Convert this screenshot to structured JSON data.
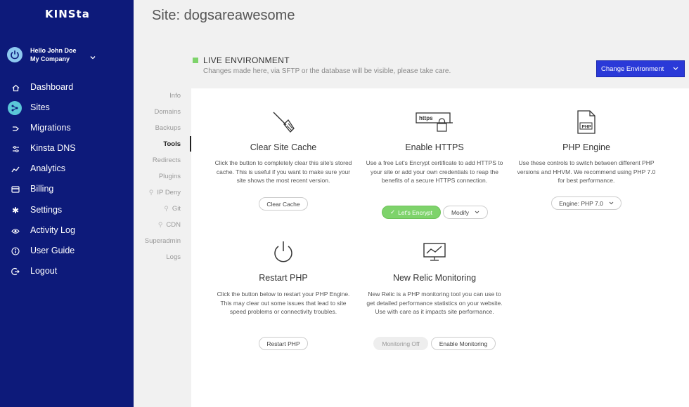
{
  "sidebar": {
    "logo": "KINSta",
    "user": {
      "hello": "Hello John Doe",
      "company": "My Company"
    },
    "items": [
      {
        "label": "Dashboard",
        "icon": "home-icon"
      },
      {
        "label": "Sites",
        "icon": "sites-icon",
        "active": true
      },
      {
        "label": "Migrations",
        "icon": "migrations-icon"
      },
      {
        "label": "Kinsta DNS",
        "icon": "dns-icon"
      },
      {
        "label": "Analytics",
        "icon": "analytics-icon"
      },
      {
        "label": "Billing",
        "icon": "billing-icon"
      },
      {
        "label": "Settings",
        "icon": "gear-icon"
      },
      {
        "label": "Activity Log",
        "icon": "eye-icon"
      },
      {
        "label": "User Guide",
        "icon": "info-icon"
      },
      {
        "label": "Logout",
        "icon": "logout-icon"
      }
    ]
  },
  "header": {
    "title": "Site: dogsareawesome",
    "env_title": "LIVE ENVIRONMENT",
    "env_desc": "Changes made here, via SFTP or the database will be visible, please take care.",
    "change_env": "Change Environment"
  },
  "subnav": [
    "Info",
    "Domains",
    "Backups",
    "Tools",
    "Redirects",
    "Plugins",
    "IP Deny",
    "Git",
    "CDN",
    "Superadmin",
    "Logs"
  ],
  "tools": {
    "cache": {
      "title": "Clear Site Cache",
      "desc": "Click the button to completely clear this site's stored cache. This is useful if you want to make sure your site shows the most recent version.",
      "button": "Clear Cache"
    },
    "https": {
      "title": "Enable HTTPS",
      "desc": "Use a free Let's Encrypt certificate to add HTTPS to your site or add your own credentials to reap the benefits of a secure HTTPS connection.",
      "button_primary": "Let's Encrypt",
      "button_secondary": "Modify",
      "icon_text": "https"
    },
    "php": {
      "title": "PHP Engine",
      "desc": "Use these controls to switch between different PHP versions and HHVM. We recommend using PHP 7.0 for best performance.",
      "button": "Engine: PHP 7.0",
      "icon_text": "PHP"
    },
    "restart": {
      "title": "Restart PHP",
      "desc": "Click the button below to restart your PHP Engine. This may clear out some issues that lead to site speed problems or connectivity troubles.",
      "button": "Restart PHP"
    },
    "relic": {
      "title": "New Relic Monitoring",
      "desc": "New Relic is a PHP monitoring tool you can use to get detailed performance statistics on your website. Use with care as it impacts site performance.",
      "button_off": "Monitoring Off",
      "button_enable": "Enable Monitoring"
    }
  }
}
